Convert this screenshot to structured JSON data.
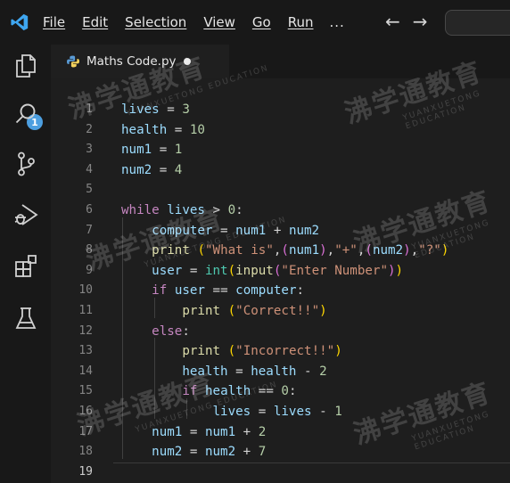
{
  "menu": {
    "items": [
      "File",
      "Edit",
      "Selection",
      "View",
      "Go",
      "Run"
    ],
    "more": "..."
  },
  "nav": {
    "back": "←",
    "forward": "→"
  },
  "activity_bar": {
    "explorer_badge": "1",
    "icons": [
      "files-icon",
      "search-icon",
      "source-control-icon",
      "run-debug-icon",
      "extensions-icon",
      "testing-icon"
    ]
  },
  "tab": {
    "label": "Maths Code.py",
    "modified": true
  },
  "editor": {
    "active_line": 19,
    "line_numbers": [
      "1",
      "2",
      "3",
      "4",
      "5",
      "6",
      "7",
      "8",
      "9",
      "10",
      "11",
      "12",
      "13",
      "14",
      "15",
      "16",
      "17",
      "18",
      "19"
    ],
    "lines": [
      [
        [
          "var",
          "lives"
        ],
        [
          "op",
          " = "
        ],
        [
          "num",
          "3"
        ]
      ],
      [
        [
          "var",
          "health"
        ],
        [
          "op",
          " = "
        ],
        [
          "num",
          "10"
        ]
      ],
      [
        [
          "var",
          "num1"
        ],
        [
          "op",
          " = "
        ],
        [
          "num",
          "1"
        ]
      ],
      [
        [
          "var",
          "num2"
        ],
        [
          "op",
          " = "
        ],
        [
          "num",
          "4"
        ]
      ],
      [],
      [
        [
          "kw",
          "while"
        ],
        [
          "op",
          " "
        ],
        [
          "var",
          "lives"
        ],
        [
          "op",
          " > "
        ],
        [
          "num",
          "0"
        ],
        [
          "op",
          ":"
        ]
      ],
      [
        [
          "op",
          "    "
        ],
        [
          "var",
          "computer"
        ],
        [
          "op",
          " = "
        ],
        [
          "var",
          "num1"
        ],
        [
          "op",
          " + "
        ],
        [
          "var",
          "num2"
        ]
      ],
      [
        [
          "op",
          "    "
        ],
        [
          "fn",
          "print"
        ],
        [
          "op",
          " "
        ],
        [
          "br1",
          "("
        ],
        [
          "str",
          "\"What is\""
        ],
        [
          "op",
          ","
        ],
        [
          "br2",
          "("
        ],
        [
          "var",
          "num1"
        ],
        [
          "br2",
          ")"
        ],
        [
          "op",
          ","
        ],
        [
          "str",
          "\"+\""
        ],
        [
          "op",
          ","
        ],
        [
          "br2",
          "("
        ],
        [
          "var",
          "num2"
        ],
        [
          "br2",
          ")"
        ],
        [
          "op",
          ","
        ],
        [
          "str",
          "\"?\""
        ],
        [
          "br1",
          ")"
        ]
      ],
      [
        [
          "op",
          "    "
        ],
        [
          "var",
          "user"
        ],
        [
          "op",
          " = "
        ],
        [
          "cls",
          "int"
        ],
        [
          "br1",
          "("
        ],
        [
          "fn",
          "input"
        ],
        [
          "br2",
          "("
        ],
        [
          "str",
          "\"Enter Number\""
        ],
        [
          "br2",
          ")"
        ],
        [
          "br1",
          ")"
        ]
      ],
      [
        [
          "op",
          "    "
        ],
        [
          "kw",
          "if"
        ],
        [
          "op",
          " "
        ],
        [
          "var",
          "user"
        ],
        [
          "op",
          " == "
        ],
        [
          "var",
          "computer"
        ],
        [
          "op",
          ":"
        ]
      ],
      [
        [
          "op",
          "        "
        ],
        [
          "fn",
          "print"
        ],
        [
          "op",
          " "
        ],
        [
          "br1",
          "("
        ],
        [
          "str",
          "\"Correct!!\""
        ],
        [
          "br1",
          ")"
        ]
      ],
      [
        [
          "op",
          "    "
        ],
        [
          "kw",
          "else"
        ],
        [
          "op",
          ":"
        ]
      ],
      [
        [
          "op",
          "        "
        ],
        [
          "fn",
          "print"
        ],
        [
          "op",
          " "
        ],
        [
          "br1",
          "("
        ],
        [
          "str",
          "\"Incorrect!!\""
        ],
        [
          "br1",
          ")"
        ]
      ],
      [
        [
          "op",
          "        "
        ],
        [
          "var",
          "health"
        ],
        [
          "op",
          " = "
        ],
        [
          "var",
          "health"
        ],
        [
          "op",
          " - "
        ],
        [
          "num",
          "2"
        ]
      ],
      [
        [
          "op",
          "        "
        ],
        [
          "kw",
          "if"
        ],
        [
          "op",
          " "
        ],
        [
          "var",
          "health"
        ],
        [
          "op",
          " == "
        ],
        [
          "num",
          "0"
        ],
        [
          "op",
          ":"
        ]
      ],
      [
        [
          "op",
          "            "
        ],
        [
          "var",
          "lives"
        ],
        [
          "op",
          " = "
        ],
        [
          "var",
          "lives"
        ],
        [
          "op",
          " - "
        ],
        [
          "num",
          "1"
        ]
      ],
      [
        [
          "op",
          "    "
        ],
        [
          "var",
          "num1"
        ],
        [
          "op",
          " = "
        ],
        [
          "var",
          "num1"
        ],
        [
          "op",
          " + "
        ],
        [
          "num",
          "2"
        ]
      ],
      [
        [
          "op",
          "    "
        ],
        [
          "var",
          "num2"
        ],
        [
          "op",
          " = "
        ],
        [
          "var",
          "num2"
        ],
        [
          "op",
          " + "
        ],
        [
          "num",
          "7"
        ]
      ],
      []
    ]
  },
  "watermark": {
    "cn": "沸学通教育",
    "en": "YUANXUETONG EDUCATION"
  },
  "colors": {
    "keyword": "#c586c0",
    "variable": "#9cdcfe",
    "number": "#b5cea8",
    "string": "#ce9178",
    "function": "#dcdcaa",
    "class": "#4ec9b0",
    "accent": "#4d9fe0"
  }
}
